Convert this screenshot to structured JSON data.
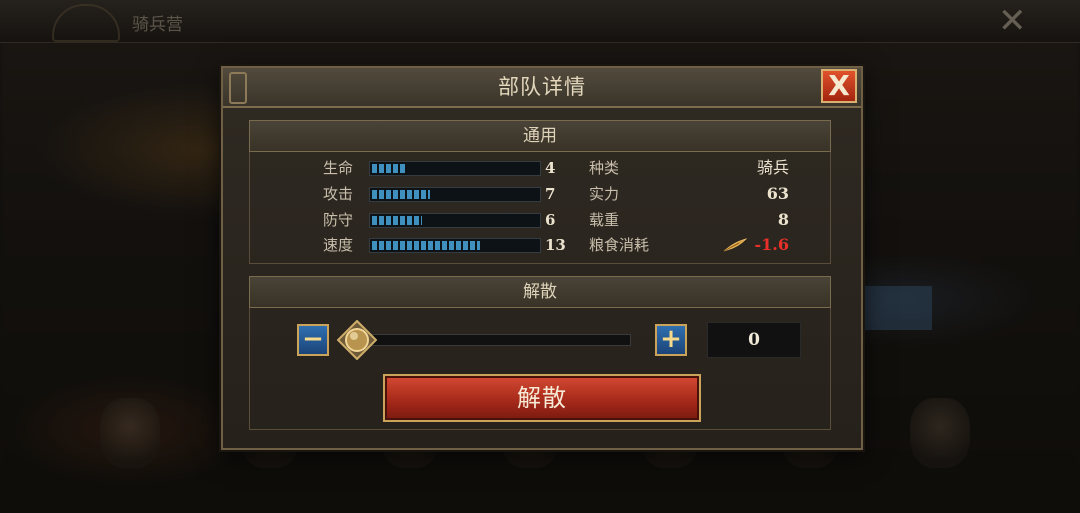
{
  "topbar": {
    "title": "骑兵营",
    "close_glyph": "✕"
  },
  "dialog": {
    "title": "部队详情",
    "close_label": "X",
    "general_section": "通用",
    "stats": [
      {
        "label": "生命",
        "value": "4",
        "level": 4
      },
      {
        "label": "攻击",
        "value": "7",
        "level": 7
      },
      {
        "label": "防守",
        "value": "6",
        "level": 6
      },
      {
        "label": "速度",
        "value": "13",
        "level": 13
      }
    ],
    "stat_max_level": 20,
    "info": [
      {
        "label": "种类",
        "value": "骑兵"
      },
      {
        "label": "实力",
        "value": "63"
      },
      {
        "label": "载重",
        "value": "8"
      },
      {
        "label": "粮食消耗",
        "value": "-1.6",
        "icon": "feather-icon"
      }
    ],
    "dismiss_section": "解散",
    "minus_label": "−",
    "plus_label": "+",
    "amount": "0",
    "slider_fraction": 0,
    "dismiss_button": "解散"
  },
  "colors": {
    "accent_gold": "#c9a45a",
    "bar_blue": "#3f8fbf",
    "negative_red": "#e8302a",
    "button_red": "#a72a1a"
  }
}
